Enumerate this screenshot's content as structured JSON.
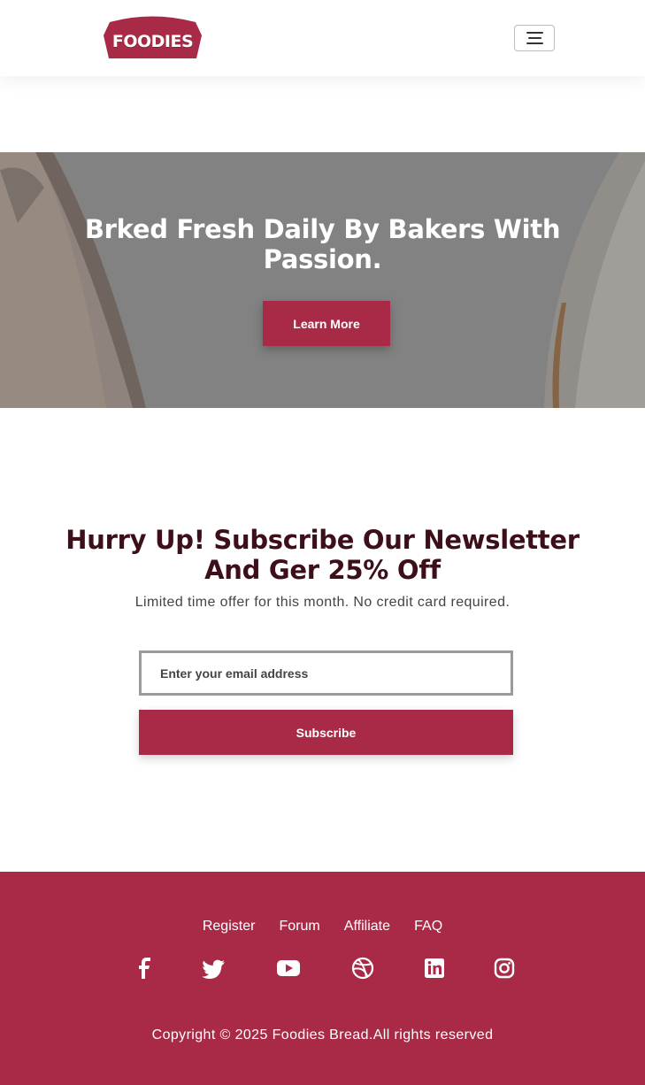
{
  "header": {
    "logo_text": "FOODIES",
    "menu_icon": "hamburger-icon"
  },
  "hero": {
    "title": "Brked Fresh Daily By Bakers With Passion.",
    "button_label": "Learn More"
  },
  "newsletter": {
    "title": "Hurry Up! Subscribe Our Newsletter And Ger 25% Off",
    "subtitle": "Limited time offer for this month. No credit card required.",
    "email_placeholder": "Enter your email address",
    "button_label": "Subscribe"
  },
  "footer": {
    "links": [
      "Register",
      "Forum",
      "Affiliate",
      "FAQ"
    ],
    "socials": [
      "facebook-icon",
      "twitter-icon",
      "youtube-icon",
      "dribbble-icon",
      "linkedin-icon",
      "instagram-icon"
    ],
    "copyright": "Copyright © 2025 Foodies Bread.All rights reserved"
  },
  "colors": {
    "brand": "#a92a46",
    "heading": "#3d1019",
    "hero_overlay": "#8a8a8a"
  }
}
